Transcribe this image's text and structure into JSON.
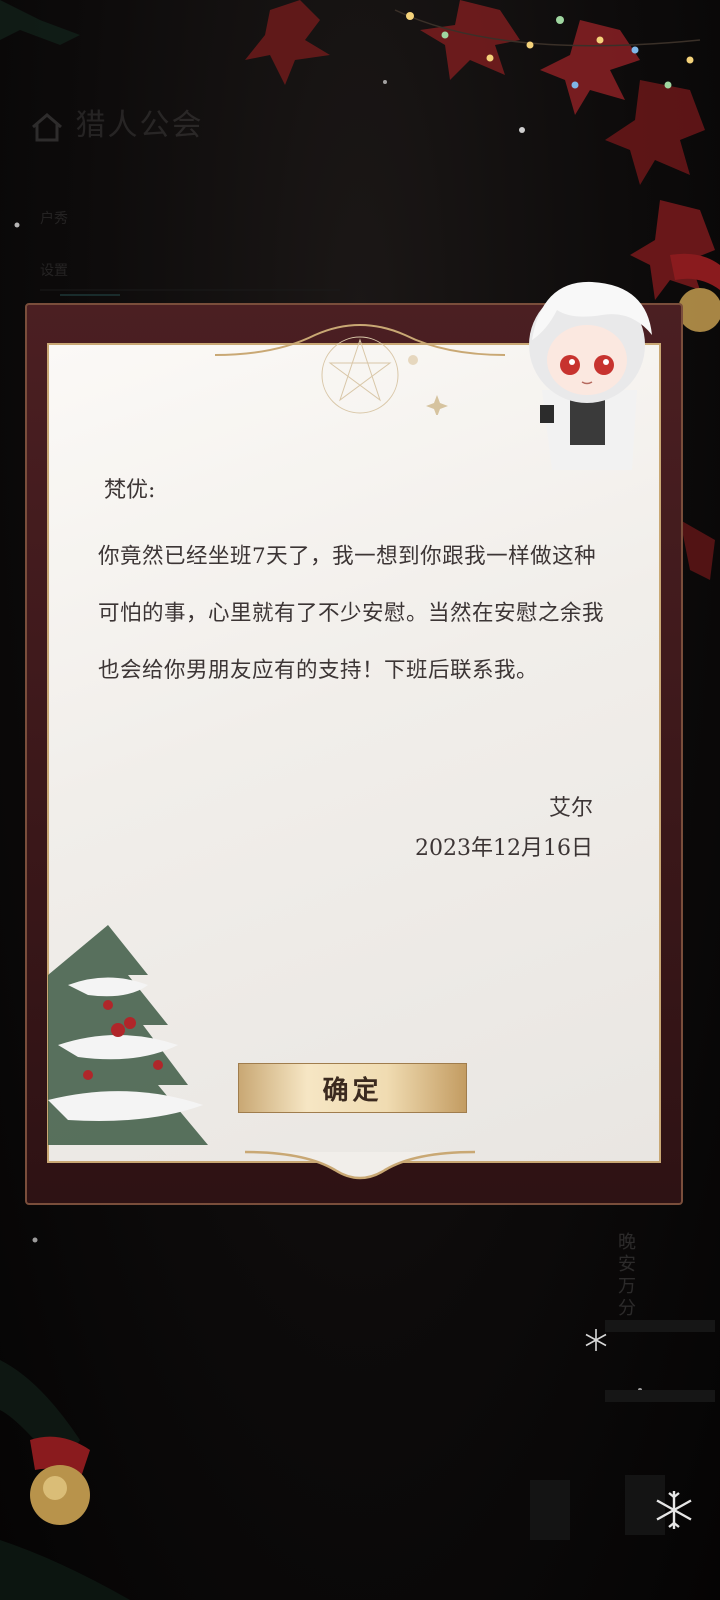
{
  "background": {
    "header_title": "猎人公会",
    "side_labels": [
      "户秀",
      "设置"
    ],
    "bottom_vertical_text": "晚安万分"
  },
  "letter": {
    "greeting": "梵优:",
    "body": "你竟然已经坐班7天了，我一想到你跟我一样做这种可怕的事，心里就有了不少安慰。当然在安慰之余我也会给你男朋友应有的支持！下班后联系我。",
    "signature": "艾尔",
    "date": "2023年12月16日"
  },
  "confirm_button": {
    "label": "确定"
  },
  "colors": {
    "frame": "#4b1f22",
    "paper": "#f4f1ed",
    "gold": "#c9a874",
    "text": "#3c3535"
  },
  "icons": [
    "home-icon",
    "snowflake-icon",
    "christmas-tree-icon",
    "avatar-icon",
    "ornament-icon"
  ]
}
